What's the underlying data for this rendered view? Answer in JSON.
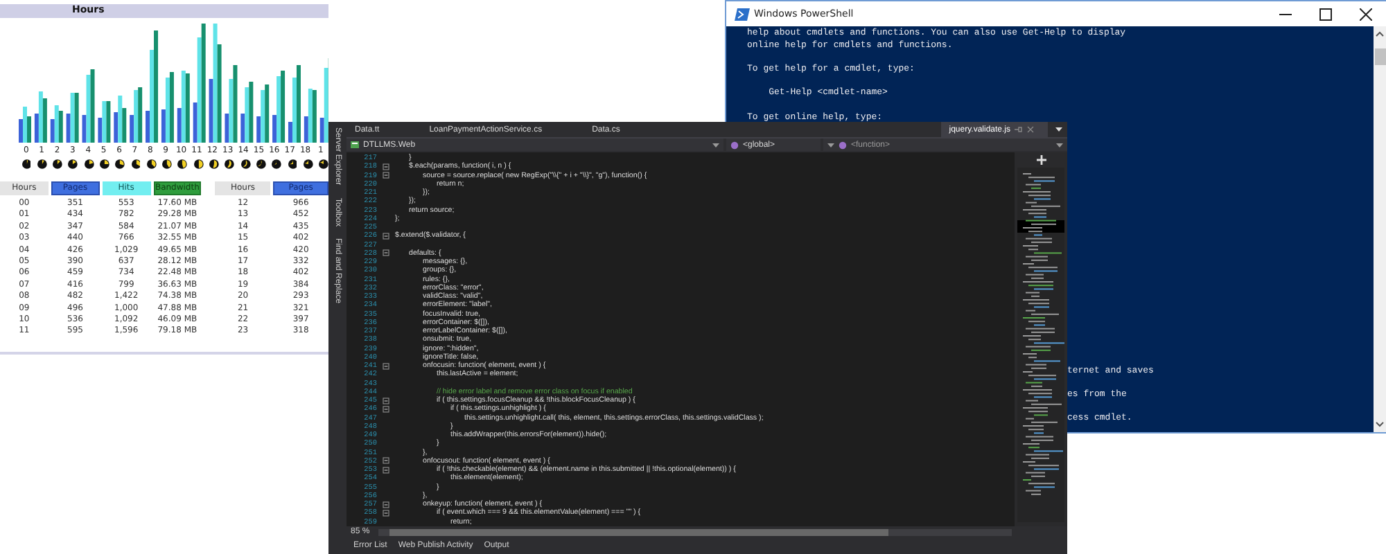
{
  "stats": {
    "header": "Hours",
    "hour_labels": [
      "0",
      "1",
      "2",
      "3",
      "4",
      "5",
      "6",
      "7",
      "8",
      "9",
      "10",
      "11",
      "12",
      "13",
      "14",
      "15",
      "16",
      "17",
      "18",
      "1"
    ],
    "tables": [
      {
        "columns": [
          {
            "label": "Hours",
            "kind": "hours"
          },
          {
            "label": "Pages",
            "kind": "pages"
          },
          {
            "label": "Hits",
            "kind": "hits"
          },
          {
            "label": "Bandwidth",
            "kind": "bandwidth"
          }
        ],
        "rows": [
          [
            "00",
            "351",
            "553",
            "17.60 MB"
          ],
          [
            "01",
            "434",
            "782",
            "29.28 MB"
          ],
          [
            "02",
            "347",
            "584",
            "21.07 MB"
          ],
          [
            "03",
            "440",
            "766",
            "32.55 MB"
          ],
          [
            "04",
            "426",
            "1,029",
            "49.65 MB"
          ],
          [
            "05",
            "390",
            "637",
            "28.12 MB"
          ],
          [
            "06",
            "459",
            "734",
            "22.48 MB"
          ],
          [
            "07",
            "416",
            "799",
            "36.63 MB"
          ],
          [
            "08",
            "482",
            "1,422",
            "74.38 MB"
          ],
          [
            "09",
            "496",
            "1,000",
            "47.88 MB"
          ],
          [
            "10",
            "536",
            "1,092",
            "46.09 MB"
          ],
          [
            "11",
            "595",
            "1,596",
            "79.18 MB"
          ]
        ]
      },
      {
        "columns": [
          {
            "label": "Hours",
            "kind": "hours"
          },
          {
            "label": "Pages",
            "kind": "pages"
          }
        ],
        "rows": [
          [
            "12",
            "966"
          ],
          [
            "13",
            "452"
          ],
          [
            "14",
            "435"
          ],
          [
            "15",
            "402"
          ],
          [
            "16",
            "420"
          ],
          [
            "17",
            "332"
          ],
          [
            "18",
            "402"
          ],
          [
            "19",
            "384"
          ],
          [
            "20",
            "293"
          ],
          [
            "21",
            "321"
          ],
          [
            "22",
            "397"
          ],
          [
            "23",
            "318"
          ]
        ]
      }
    ]
  },
  "powershell": {
    "title": "Windows PowerShell",
    "blocks": [
      [
        "help about cmdlets and functions. You can also use Get-Help to display",
        "online help for cmdlets and functions."
      ],
      [
        "To get help for a cmdlet, type:"
      ],
      [
        "    Get-Help <cmdlet-name>"
      ],
      [
        "To get online help, type:"
      ]
    ],
    "fragments": [
      "ternet and saves",
      "es from the",
      "cess cmdlet."
    ]
  },
  "editor": {
    "side_tabs": [
      "Server Explorer",
      "Toolbox",
      "Find and Replace"
    ],
    "tabs": [
      {
        "label": "Data.tt",
        "kind": "document",
        "selected": false
      },
      {
        "label": "LoanPaymentActionService.cs",
        "kind": "document",
        "selected": false
      },
      {
        "label": "Data.cs",
        "kind": "document",
        "selected": false
      },
      {
        "label": "jquery.validate.js",
        "kind": "preview",
        "selected": true
      }
    ],
    "nav": {
      "project": "DTLLMS.Web",
      "scope": "<global>",
      "member": "<function>"
    },
    "lines": [
      {
        "number": "217",
        "text": "\t}",
        "fold": false,
        "kind": "code"
      },
      {
        "number": "218",
        "text": "\t$.each(params, function( i, n ) {",
        "fold": true,
        "kind": "code"
      },
      {
        "number": "219",
        "text": "\t\tsource = source.replace( new RegExp(\"\\\\{\" + i + \"\\\\}\", \"g\"), function() {",
        "fold": true,
        "kind": "code"
      },
      {
        "number": "220",
        "text": "\t\t\treturn n;",
        "fold": false,
        "kind": "code"
      },
      {
        "number": "221",
        "text": "\t\t});",
        "fold": false,
        "kind": "code"
      },
      {
        "number": "222",
        "text": "\t});",
        "fold": false,
        "kind": "code"
      },
      {
        "number": "223",
        "text": "\treturn source;",
        "fold": false,
        "kind": "code"
      },
      {
        "number": "224",
        "text": "};",
        "fold": false,
        "kind": "code"
      },
      {
        "number": "225",
        "fold": false
      },
      {
        "number": "226",
        "text": "$.extend($.validator, {",
        "fold": true,
        "kind": "code"
      },
      {
        "number": "227",
        "fold": false
      },
      {
        "number": "228",
        "text": "\tdefaults: {",
        "fold": true,
        "kind": "code"
      },
      {
        "number": "229",
        "text": "\t\tmessages: {},",
        "fold": false,
        "kind": "code"
      },
      {
        "number": "230",
        "text": "\t\tgroups: {},",
        "fold": false,
        "kind": "code"
      },
      {
        "number": "231",
        "text": "\t\trules: {},",
        "fold": false,
        "kind": "code"
      },
      {
        "number": "232",
        "text": "\t\terrorClass: \"error\",",
        "fold": false,
        "kind": "code"
      },
      {
        "number": "233",
        "text": "\t\tvalidClass: \"valid\",",
        "fold": false,
        "kind": "code"
      },
      {
        "number": "234",
        "text": "\t\terrorElement: \"label\",",
        "fold": false,
        "kind": "code"
      },
      {
        "number": "235",
        "text": "\t\tfocusInvalid: true,",
        "fold": false,
        "kind": "code"
      },
      {
        "number": "236",
        "text": "\t\terrorContainer: $([]),",
        "fold": false,
        "kind": "code"
      },
      {
        "number": "237",
        "text": "\t\terrorLabelContainer: $([]),",
        "fold": false,
        "kind": "code"
      },
      {
        "number": "238",
        "text": "\t\tonsubmit: true,",
        "fold": false,
        "kind": "code"
      },
      {
        "number": "239",
        "text": "\t\tignore: \":hidden\",",
        "fold": false,
        "kind": "code"
      },
      {
        "number": "240",
        "text": "\t\tignoreTitle: false,",
        "fold": false,
        "kind": "code"
      },
      {
        "number": "241",
        "text": "\t\tonfocusin: function( element, event ) {",
        "fold": true,
        "kind": "code"
      },
      {
        "number": "242",
        "text": "\t\t\tthis.lastActive = element;",
        "fold": false,
        "kind": "code"
      },
      {
        "number": "243",
        "fold": false
      },
      {
        "number": "244",
        "text": "\t\t\t// hide error label and remove error class on focus if enabled",
        "fold": false,
        "kind": "comment"
      },
      {
        "number": "245",
        "text": "\t\t\tif ( this.settings.focusCleanup && !this.blockFocusCleanup ) {",
        "fold": true,
        "kind": "code"
      },
      {
        "number": "246",
        "text": "\t\t\t\tif ( this.settings.unhighlight ) {",
        "fold": true,
        "kind": "code"
      },
      {
        "number": "247",
        "text": "\t\t\t\t\tthis.settings.unhighlight.call( this, element, this.settings.errorClass, this.settings.validClass );",
        "fold": false,
        "kind": "code"
      },
      {
        "number": "248",
        "text": "\t\t\t\t}",
        "fold": false,
        "kind": "code"
      },
      {
        "number": "249",
        "text": "\t\t\t\tthis.addWrapper(this.errorsFor(element)).hide();",
        "fold": false,
        "kind": "code"
      },
      {
        "number": "250",
        "text": "\t\t\t}",
        "fold": false,
        "kind": "code"
      },
      {
        "number": "251",
        "text": "\t\t},",
        "fold": false,
        "kind": "code"
      },
      {
        "number": "252",
        "text": "\t\tonfocusout: function( element, event ) {",
        "fold": true,
        "kind": "code"
      },
      {
        "number": "253",
        "text": "\t\t\tif ( !this.checkable(element) && (element.name in this.submitted || !this.optional(element)) ) {",
        "fold": true,
        "kind": "code"
      },
      {
        "number": "254",
        "text": "\t\t\t\tthis.element(element);",
        "fold": false,
        "kind": "code"
      },
      {
        "number": "255",
        "text": "\t\t\t}",
        "fold": false,
        "kind": "code"
      },
      {
        "number": "256",
        "text": "\t\t},",
        "fold": false,
        "kind": "code"
      },
      {
        "number": "257",
        "text": "\t\tonkeyup: function( element, event ) {",
        "fold": true,
        "kind": "code"
      },
      {
        "number": "258",
        "text": "\t\t\tif ( event.which === 9 && this.elementValue(element) === \"\" ) {",
        "fold": true,
        "kind": "code"
      },
      {
        "number": "259",
        "text": "\t\t\t\treturn;",
        "fold": false,
        "kind": "code"
      }
    ],
    "zoom": "85 %",
    "panel_tabs": [
      "Error List",
      "Web Publish Activity",
      "Output"
    ]
  }
}
